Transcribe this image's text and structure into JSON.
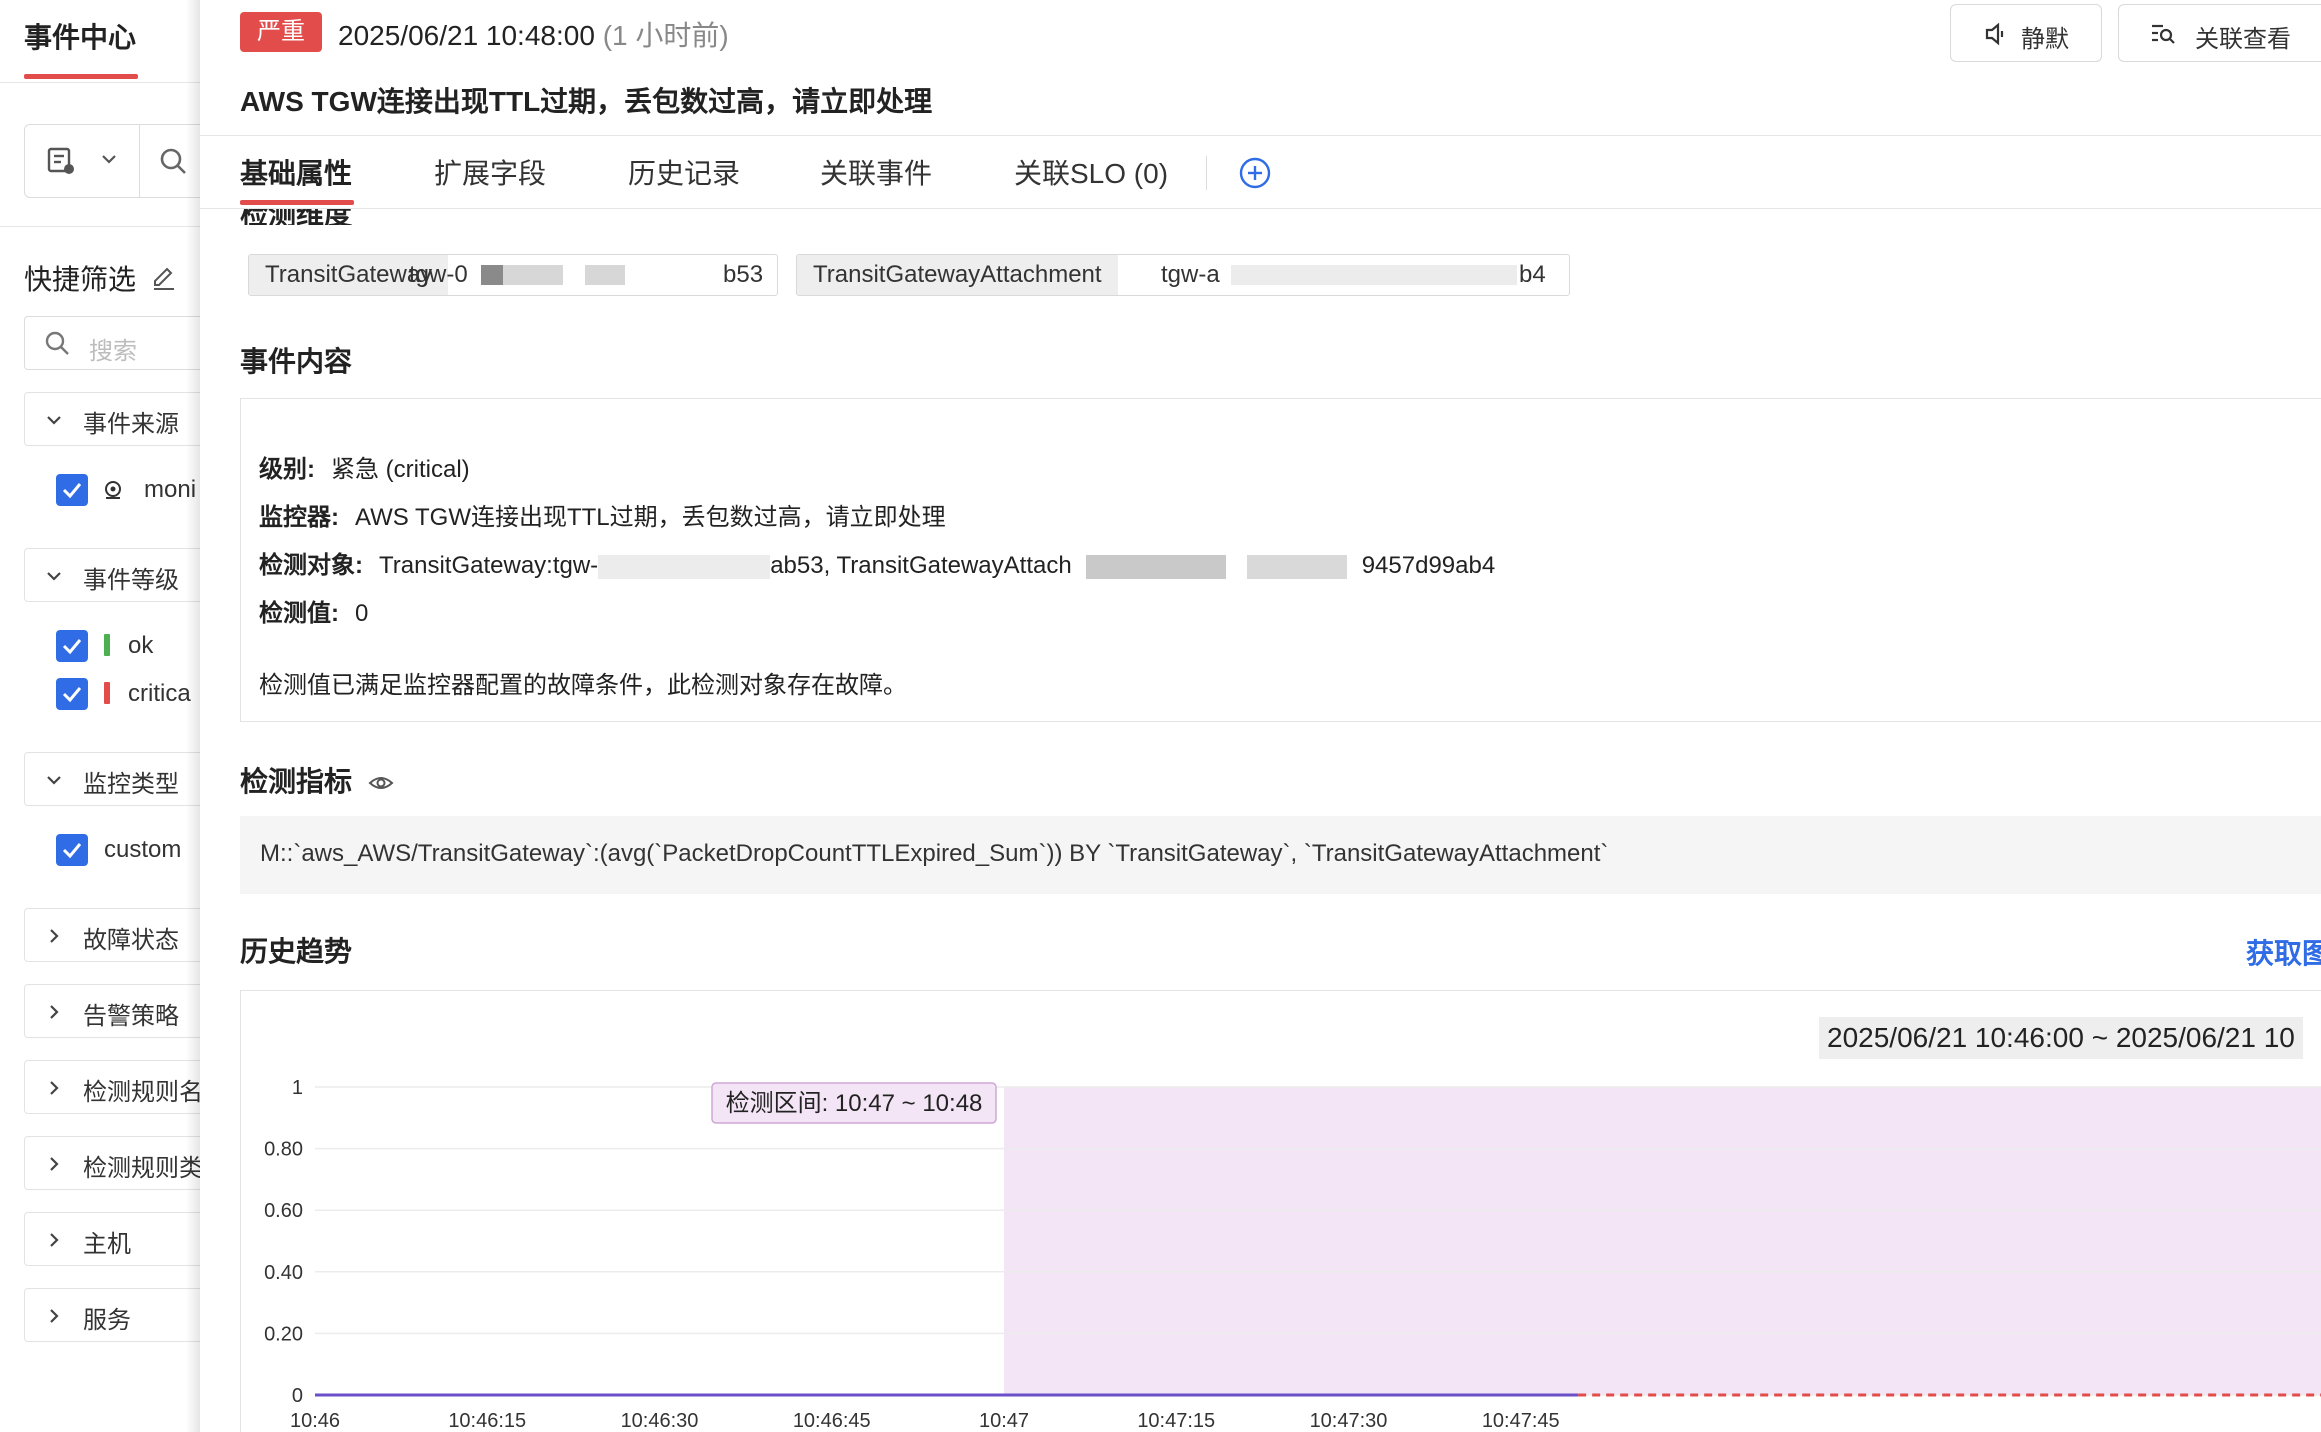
{
  "sidebar": {
    "title": "事件中心",
    "quick_filter_label": "快捷筛选",
    "search_placeholder": "搜索",
    "groups": [
      {
        "label": "事件来源",
        "expanded": true,
        "options": [
          {
            "label": "moni",
            "icon": "monitor-icon"
          }
        ]
      },
      {
        "label": "事件等级",
        "expanded": true,
        "options": [
          {
            "label": "ok",
            "color": "#4caf50"
          },
          {
            "label": "critica",
            "color": "#e24c4b"
          }
        ]
      },
      {
        "label": "监控类型",
        "expanded": true,
        "options": [
          {
            "label": "custom"
          }
        ]
      },
      {
        "label": "故障状态",
        "expanded": false
      },
      {
        "label": "告警策略",
        "expanded": false
      },
      {
        "label": "检测规则名",
        "expanded": false
      },
      {
        "label": "检测规则类",
        "expanded": false
      },
      {
        "label": "主机",
        "expanded": false
      },
      {
        "label": "服务",
        "expanded": false
      }
    ]
  },
  "header": {
    "severity_badge": "严重",
    "severity_color": "#e24c4b",
    "time": "2025/06/21 10:48:00",
    "relative_time": "(1 小时前)",
    "mute_button": "静默",
    "related_view_button": "关联查看",
    "title": "AWS TGW连接出现TTL过期，丢包数过高，请立即处理"
  },
  "tabs": [
    {
      "label": "基础属性",
      "active": true
    },
    {
      "label": "扩展字段",
      "active": false
    },
    {
      "label": "历史记录",
      "active": false
    },
    {
      "label": "关联事件",
      "active": false
    },
    {
      "label": "关联SLO (0)",
      "active": false
    }
  ],
  "dimensions": {
    "title": "检测维度",
    "tags": [
      {
        "key": "TransitGateway",
        "value_prefix": "tgw-0",
        "value_suffix": "b53"
      },
      {
        "key": "TransitGatewayAttachment",
        "value_prefix": "tgw-a",
        "value_suffix": "b4"
      }
    ]
  },
  "event_content": {
    "title": "事件内容",
    "level_label": "级别:",
    "level_value": "紧急 (critical)",
    "monitor_label": "监控器:",
    "monitor_value": "AWS TGW连接出现TTL过期，丢包数过高，请立即处理",
    "object_label": "检测对象:",
    "object_part1": "TransitGateway:tgw-",
    "object_part2": "ab53, TransitGatewayAttach",
    "object_part3": "9457d99ab4",
    "value_label": "检测值:",
    "value_value": "0",
    "description": "检测值已满足监控器配置的故障条件，此检测对象存在故障。"
  },
  "metric": {
    "title": "检测指标",
    "expression": "M::`aws_AWS/TransitGateway`:(avg(`PacketDropCountTTLExpired_Sum`)) BY `TransitGateway`, `TransitGatewayAttachment`"
  },
  "history": {
    "title": "历史趋势",
    "get_chart_link": "获取图",
    "time_range": "2025/06/21 10:46:00 ~ 2025/06/21 10",
    "detection_interval": "检测区间: 10:47 ~ 10:48"
  },
  "chart_data": {
    "type": "line",
    "x_ticks": [
      "10:46",
      "10:46:15",
      "10:46:30",
      "10:46:45",
      "10:47",
      "10:47:15",
      "10:47:30",
      "10:47:45"
    ],
    "y_ticks": [
      "0",
      "0.20",
      "0.40",
      "0.60",
      "0.80",
      "1"
    ],
    "ylim": [
      0,
      1
    ],
    "x_range": [
      "10:46:00",
      "10:48:00"
    ],
    "highlight_range": [
      "10:47:00",
      "10:48:00"
    ],
    "highlight_color": "#f3e5f5",
    "series": [
      {
        "x": [
          "10:46:00",
          "10:47:50"
        ],
        "values": [
          0,
          0
        ],
        "color": "#6a4fc8",
        "style": "solid"
      },
      {
        "x": [
          "10:47:50",
          "10:48:00"
        ],
        "values": [
          0,
          0
        ],
        "color": "#e24c4b",
        "style": "dashed"
      }
    ],
    "grid": true
  }
}
